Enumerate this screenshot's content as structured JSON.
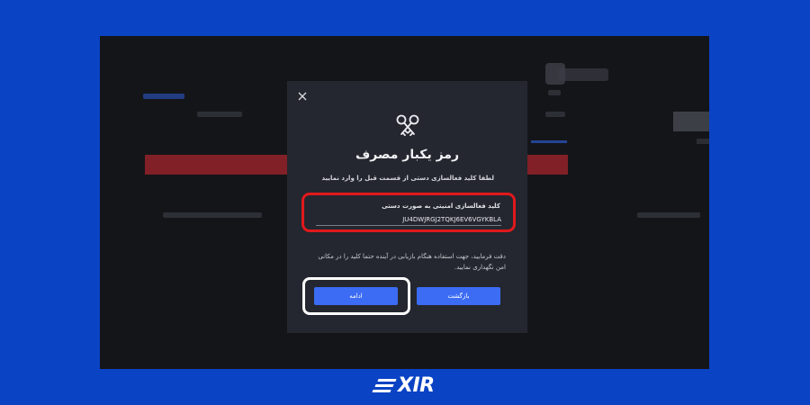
{
  "modal": {
    "title": "رمز یکبار مصرف",
    "subtitle": "لطفا کلید فعالسازی دستی از قسمت قبل را وارد نمایید",
    "field_label": "کلید فعالسازی امنیتی به صورت دستی",
    "field_value": "JU4DWJRGJ2TQKJ6EV6VGYKBLA",
    "notice": "دقت فرمایید، جهت استفاده هنگام بازیابی در آینده حتما کلید را در مکانی امن نگهداری نمایید.",
    "continue_label": "ادامه",
    "back_label": "بازگشت"
  },
  "logo": {
    "text": "XIR"
  },
  "colors": {
    "page_background": "#0a43c4",
    "modal_background": "#24272f",
    "primary_button": "#3c6cf3",
    "highlight_red": "#e0191c"
  }
}
